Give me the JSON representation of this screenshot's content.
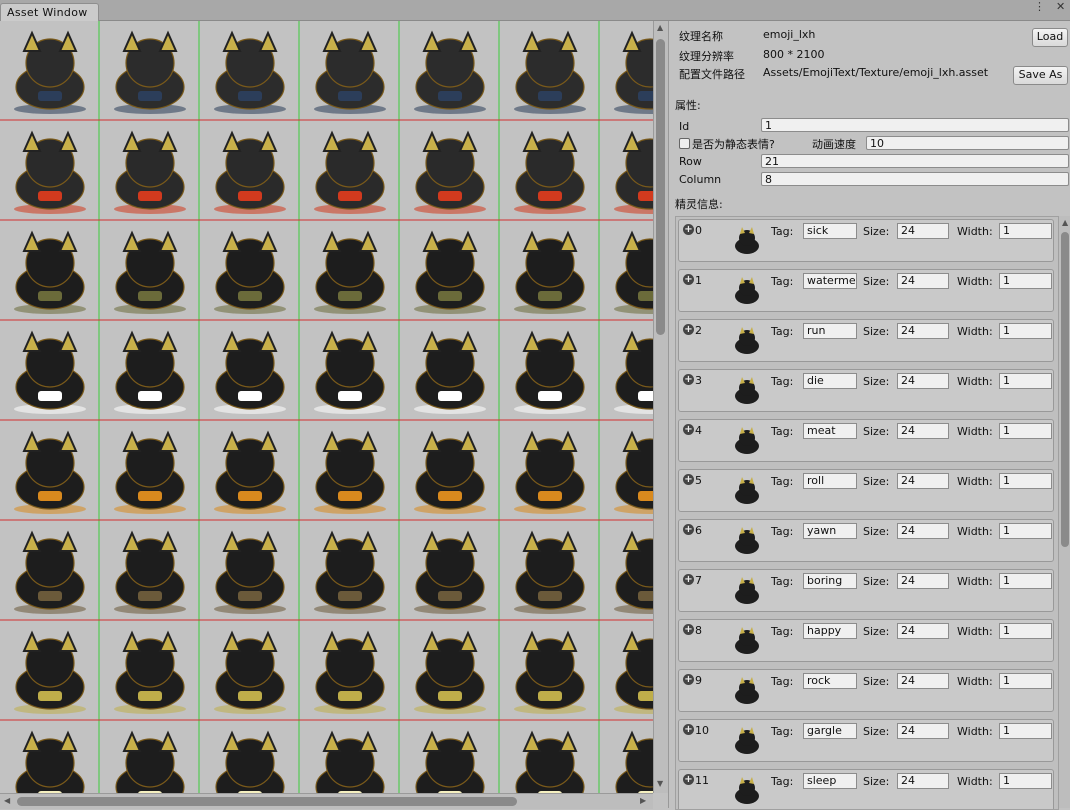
{
  "window": {
    "tab_title": "Asset Window",
    "menu_icon": "⋮",
    "close_icon": "✕"
  },
  "grid": {
    "columns": 7,
    "rows": [
      {
        "name": "sick",
        "colors": [
          "#2c2c2c",
          "#2c3e5a"
        ]
      },
      {
        "name": "watermelon",
        "colors": [
          "#2a2a2a",
          "#d23a1e"
        ]
      },
      {
        "name": "run",
        "colors": [
          "#1d1d1d",
          "#6b6b3a"
        ]
      },
      {
        "name": "die",
        "colors": [
          "#1d1d1d",
          "#ffffff"
        ]
      },
      {
        "name": "meat",
        "colors": [
          "#1d1d1d",
          "#d98a1e"
        ]
      },
      {
        "name": "roll",
        "colors": [
          "#1d1d1d",
          "#6b5a3a"
        ]
      },
      {
        "name": "yawn",
        "colors": [
          "#1d1d1d",
          "#bfae4a"
        ]
      },
      {
        "name": "boring",
        "colors": [
          "#1d1d1d",
          "#f5f0c0"
        ]
      }
    ]
  },
  "panel": {
    "texture_name_label": "纹理名称",
    "texture_name_value": "emoji_lxh",
    "load_button": "Load",
    "resolution_label": "纹理分辨率",
    "resolution_value": "800 * 2100",
    "config_path_label": "配置文件路径",
    "config_path_value": "Assets/EmojiText/Texture/emoji_lxh.asset",
    "save_as_button": "Save As",
    "properties_label": "属性:",
    "id_label": "Id",
    "id_value": "1",
    "static_label": "是否为静态表情?",
    "anim_speed_label": "动画速度",
    "anim_speed_value": "10",
    "row_label": "Row",
    "row_value": "21",
    "column_label": "Column",
    "column_value": "8",
    "sprites_label": "精灵信息:"
  },
  "sprite_fields": {
    "tag_label": "Tag:",
    "size_label": "Size:",
    "width_label": "Width:"
  },
  "sprites": [
    {
      "index": "0",
      "tag": "sick",
      "size": "24",
      "width": "1"
    },
    {
      "index": "1",
      "tag": "watermelon",
      "size": "24",
      "width": "1"
    },
    {
      "index": "2",
      "tag": "run",
      "size": "24",
      "width": "1"
    },
    {
      "index": "3",
      "tag": "die",
      "size": "24",
      "width": "1"
    },
    {
      "index": "4",
      "tag": "meat",
      "size": "24",
      "width": "1"
    },
    {
      "index": "5",
      "tag": "roll",
      "size": "24",
      "width": "1"
    },
    {
      "index": "6",
      "tag": "yawn",
      "size": "24",
      "width": "1"
    },
    {
      "index": "7",
      "tag": "boring",
      "size": "24",
      "width": "1"
    },
    {
      "index": "8",
      "tag": "happy",
      "size": "24",
      "width": "1"
    },
    {
      "index": "9",
      "tag": "rock",
      "size": "24",
      "width": "1"
    },
    {
      "index": "10",
      "tag": "gargle",
      "size": "24",
      "width": "1"
    },
    {
      "index": "11",
      "tag": "sleep",
      "size": "24",
      "width": "1"
    }
  ]
}
